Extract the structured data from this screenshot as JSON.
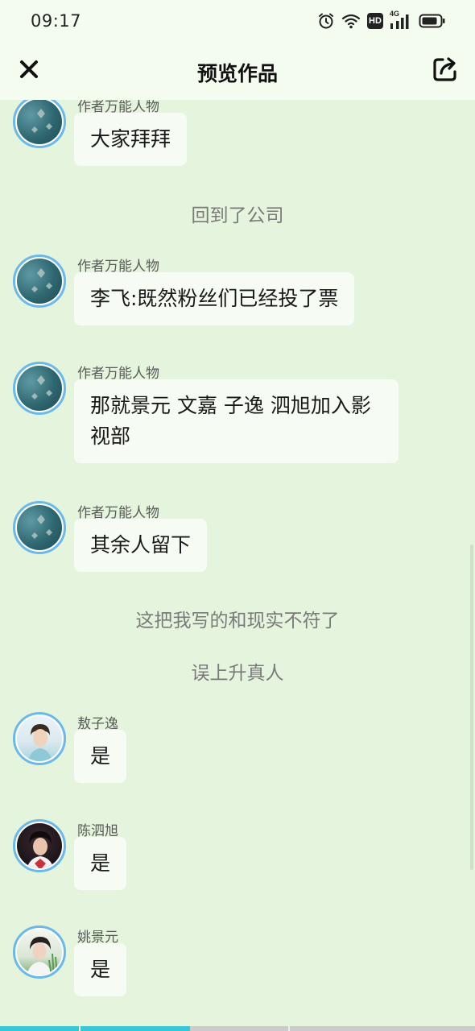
{
  "status_bar": {
    "time": "09:17",
    "network": "4G",
    "hd": "HD"
  },
  "header": {
    "title": "预览作品"
  },
  "chat": {
    "items": [
      {
        "kind": "message",
        "sender": "作者万能人物",
        "text": "大家拜拜",
        "avatar": "author"
      },
      {
        "kind": "narration",
        "text": "回到了公司"
      },
      {
        "kind": "message",
        "sender": "作者万能人物",
        "text": "李飞:既然粉丝们已经投了票",
        "avatar": "author"
      },
      {
        "kind": "message",
        "sender": "作者万能人物",
        "text": "那就景元  文嘉  子逸  泗旭加入影视部",
        "avatar": "author"
      },
      {
        "kind": "message",
        "sender": "作者万能人物",
        "text": "其余人留下",
        "avatar": "author"
      },
      {
        "kind": "narration",
        "text": "这把我写的和现实不符了"
      },
      {
        "kind": "narration",
        "text": "误上升真人"
      },
      {
        "kind": "message",
        "sender": "敖子逸",
        "text": "是",
        "avatar": "aoziyi"
      },
      {
        "kind": "message",
        "sender": "陈泗旭",
        "text": "是",
        "avatar": "chensixu"
      },
      {
        "kind": "message",
        "sender": "姚景元",
        "text": "是",
        "avatar": "yaojingyuan"
      }
    ]
  },
  "reading_progress": 0.4,
  "colors": {
    "background": "#e5f4dd",
    "header_background": "#f4fcef",
    "bubble": "#f6fbf3",
    "avatar_border": "#6cb8e8",
    "progress": "#37c7d8"
  },
  "icons": {
    "close": "close-icon",
    "share": "share-icon",
    "alarm": "alarm-icon",
    "wifi": "wifi-icon",
    "signal": "signal-icon",
    "battery": "battery-icon"
  }
}
